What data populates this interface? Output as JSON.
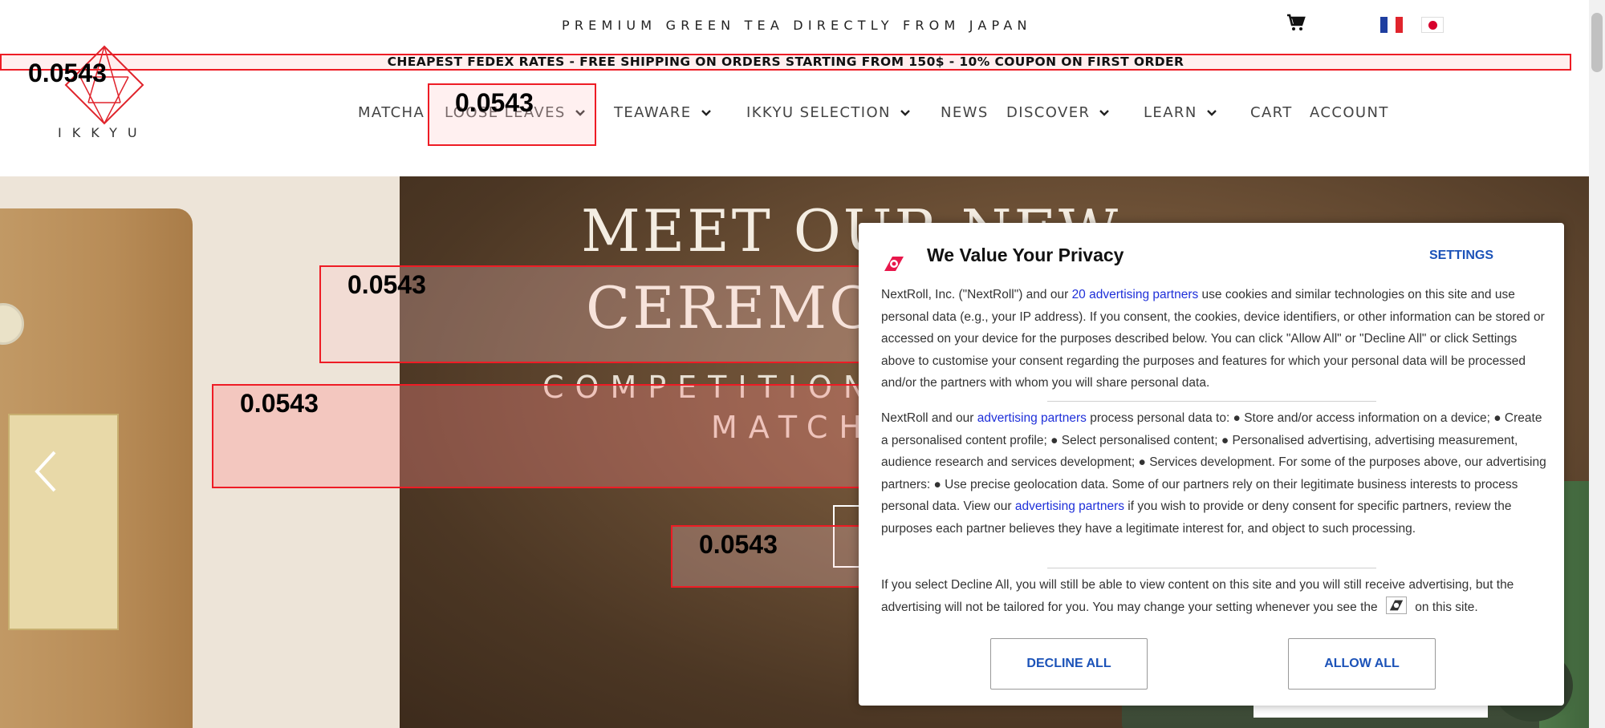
{
  "topbar": {
    "tagline": "PREMIUM GREEN TEA DIRECTLY FROM JAPAN",
    "cart_icon": "shopping-cart-icon",
    "languages": [
      "fr-flag-icon",
      "jp-flag-icon"
    ]
  },
  "announcement": {
    "text": "CHEAPEST FEDEX RATES - FREE SHIPPING ON ORDERS STARTING FROM 150$ - 10% COUPON ON FIRST ORDER"
  },
  "header": {
    "logo_text": "IKKYU",
    "nav": [
      {
        "label": "MATCHA",
        "dropdown": false
      },
      {
        "label": "LOOSE LEAVES",
        "dropdown": true
      },
      {
        "label": "TEAWARE",
        "dropdown": true
      },
      {
        "label": "IKKYU SELECTION",
        "dropdown": true
      },
      {
        "label": "NEWS",
        "dropdown": false
      },
      {
        "label": "DISCOVER",
        "dropdown": true
      },
      {
        "label": "LEARN",
        "dropdown": true
      },
      {
        "label": "CART",
        "dropdown": false
      },
      {
        "label": "ACCOUNT",
        "dropdown": false
      }
    ]
  },
  "hero": {
    "title_line1": "MEET OUR NEW",
    "title_line2": "CEREMON",
    "subtitle_line1": "COMPETITION",
    "subtitle_line2": "MATCH",
    "prev_icon": "chevron-left-icon"
  },
  "annotations": {
    "label_1": "0.0543",
    "label_2": "0.0543",
    "label_3": "0.0543",
    "label_4": "0.0543",
    "label_5": "0.0543"
  },
  "consent": {
    "title": "We Value Your Privacy",
    "settings": "SETTINGS",
    "p1_a": "NextRoll, Inc. (\"NextRoll\") and our ",
    "p1_link": "20 advertising partners",
    "p1_b": " use cookies and similar technologies on this site and use personal data (e.g., your IP address). If you consent, the cookies, device identifiers, or other information can be stored or accessed on your device for the purposes described below. You can click \"Allow All\" or \"Decline All\" or click Settings above to customise your consent regarding the purposes and features for which your personal data will be processed and/or the partners with whom you will share personal data.",
    "p2_a": "NextRoll and our ",
    "p2_link1": "advertising partners",
    "p2_b": " process personal data to: ● Store and/or access information on a device; ● Create a personalised content profile; ● Select personalised content; ● Personalised advertising, advertising measurement, audience research and services development; ● Services development. For some of the purposes above, our advertising partners: ● Use precise geolocation data. Some of our partners rely on their legitimate business interests to process personal data. View our ",
    "p2_link2": "advertising partners",
    "p2_c": " if you wish to provide or deny consent for specific partners, review the purposes each partner believes they have a legitimate interest for, and object to such processing.",
    "p3_a": "If you select Decline All, you will still be able to view content on this site and you will still receive advertising, but the advertising will not be tailored for you. You may change your setting whenever you see the",
    "p3_b": "on this site.",
    "decline": "DECLINE ALL",
    "allow": "ALLOW ALL",
    "brand_color": "#e8174b",
    "link_color": "#1e2fd9",
    "button_color": "#1b52b8"
  },
  "colors": {
    "annotation_red": "#ee1c25"
  }
}
